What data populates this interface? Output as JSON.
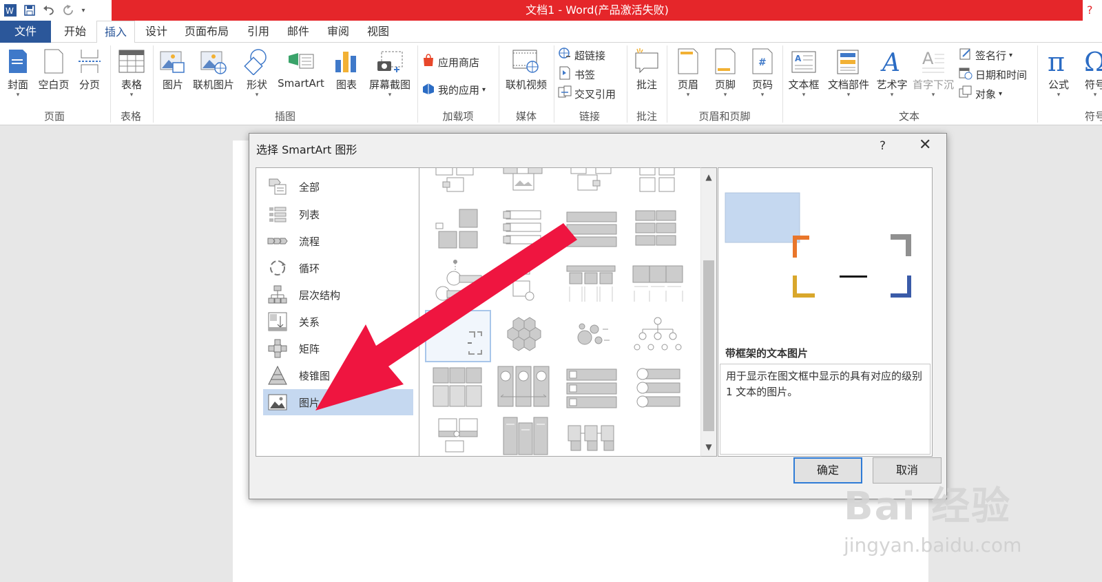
{
  "titlebar": {
    "title": "文档1 -  Word(产品激活失败)",
    "help": "?",
    "qat": {
      "word_icon": "word-logo-icon",
      "save_icon": "save-icon",
      "undo_icon": "undo-icon",
      "redo_icon": "redo-icon",
      "customize_icon": "customize-qat-icon"
    }
  },
  "tabs": {
    "file": "文件",
    "home": "开始",
    "insert": "插入",
    "design": "设计",
    "layout": "页面布局",
    "references": "引用",
    "mailings": "邮件",
    "review": "审阅",
    "view": "视图"
  },
  "ribbon": {
    "groups": {
      "pages": "页面",
      "tables": "表格",
      "illustrations": "插图",
      "addins": "加载项",
      "media": "媒体",
      "links": "链接",
      "comments": "批注",
      "header_footer": "页眉和页脚",
      "text": "文本",
      "symbols": "符号"
    },
    "buttons": {
      "cover": "封面",
      "blank": "空白页",
      "page_break": "分页",
      "table": "表格",
      "picture": "图片",
      "online_picture": "联机图片",
      "shapes": "形状",
      "smartart": "SmartArt",
      "chart": "图表",
      "screenshot": "屏幕截图",
      "store": "应用商店",
      "my_apps": "我的应用",
      "online_video": "联机视频",
      "hyperlink": "超链接",
      "bookmark": "书签",
      "cross_ref": "交叉引用",
      "comment": "批注",
      "header": "页眉",
      "footer": "页脚",
      "page_number": "页码",
      "textbox": "文本框",
      "quick_parts": "文档部件",
      "wordart": "艺术字",
      "dropcap": "首字下沉",
      "signature": "签名行",
      "datetime": "日期和时间",
      "object": "对象",
      "equation": "公式",
      "symbol": "符号"
    }
  },
  "dialog": {
    "title": "选择 SmartArt 图形",
    "help": "?",
    "close": "✕",
    "categories": [
      "全部",
      "列表",
      "流程",
      "循环",
      "层次结构",
      "关系",
      "矩阵",
      "棱锥图",
      "图片"
    ],
    "selected_category": "图片",
    "preview_name": "带框架的文本图片",
    "preview_desc": "用于显示在图文框中显示的具有对应的级别 1 文本的图片。",
    "ok": "确定",
    "cancel": "取消"
  },
  "watermark": {
    "brand": "Bai 经验",
    "url": "jingyan.baidu.com"
  },
  "colors": {
    "title_red": "#e5262a",
    "word_blue": "#2b579a",
    "arrow_red": "#ef1540",
    "selected_bg": "#c5d8f0"
  }
}
